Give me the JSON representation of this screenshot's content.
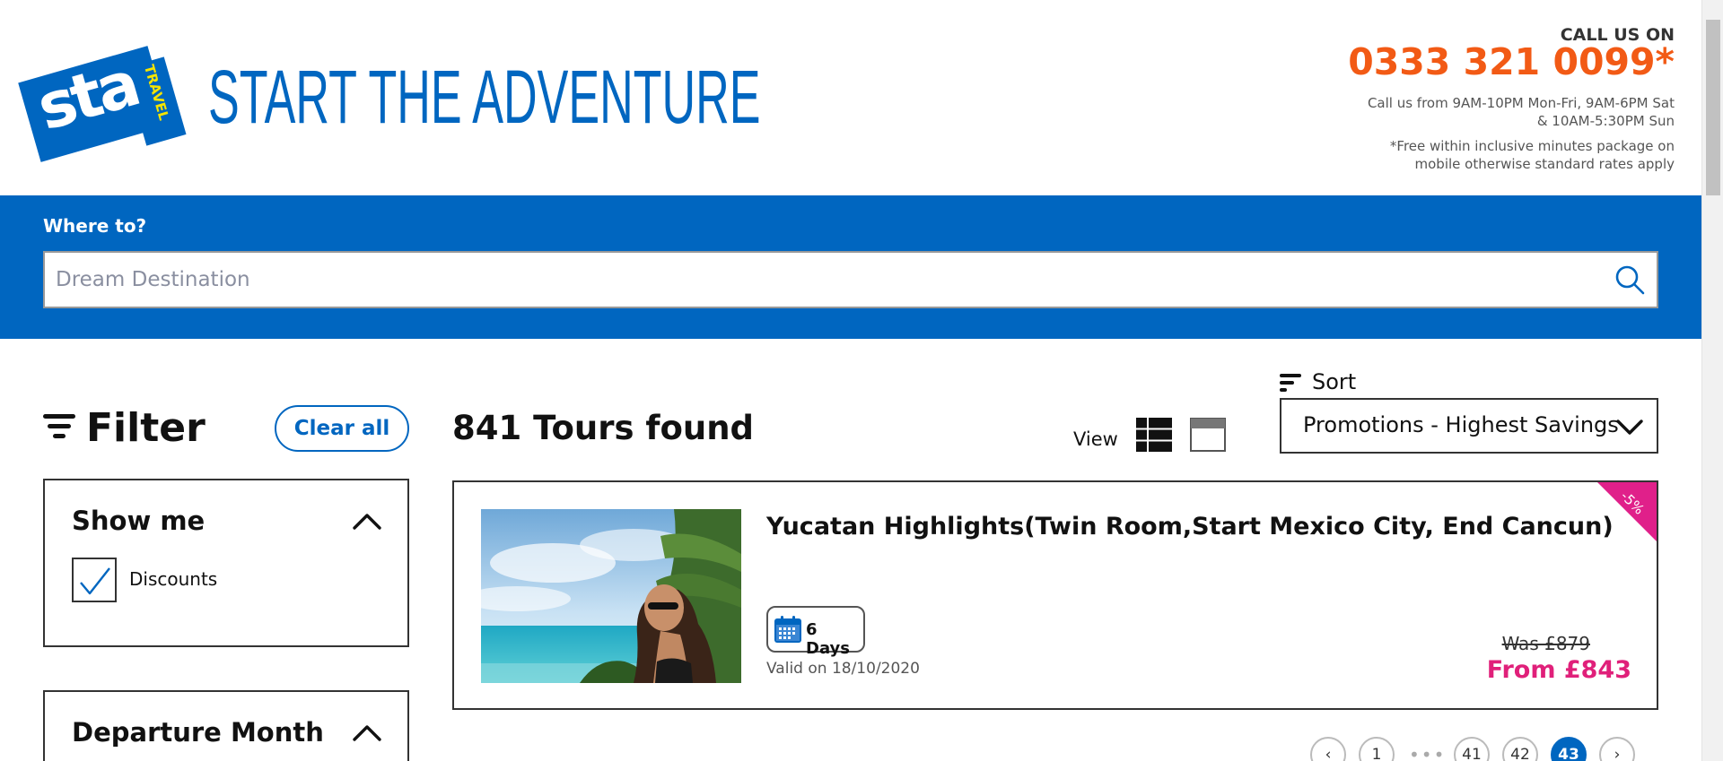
{
  "header": {
    "logo_text": "sta",
    "logo_sub": "TRAVEL",
    "tagline": "START THE ADVENTURE",
    "call_label": "CALL US ON",
    "call_number": "0333 321 0099*",
    "call_hours_1": "Call us from 9AM-10PM Mon-Fri, 9AM-6PM Sat",
    "call_hours_2": "& 10AM-5:30PM Sun",
    "call_note_1": "*Free within inclusive minutes package on",
    "call_note_2": "mobile otherwise standard rates apply"
  },
  "search": {
    "label": "Where to?",
    "placeholder": "Dream Destination",
    "value": "",
    "icon": "search-icon"
  },
  "filter": {
    "title": "Filter",
    "clear_label": "Clear all",
    "panels": [
      {
        "title": "Show me",
        "options": [
          {
            "label": "Discounts",
            "checked": true
          }
        ]
      },
      {
        "title": "Departure Month"
      }
    ]
  },
  "results": {
    "count_text": "841 Tours found",
    "view_label": "View",
    "sort_label": "Sort",
    "sort_value": "Promotions - Highest Savings"
  },
  "tours": [
    {
      "title": "Yucatan Highlights(Twin Room,Start Mexico City, End Cancun)",
      "duration": "6 Days",
      "valid": "Valid on 18/10/2020",
      "was_price": "Was £879",
      "from_price": "From £843",
      "discount": "-5%"
    }
  ],
  "pagination": {
    "pages": [
      "1",
      "41",
      "42",
      "43"
    ],
    "current": "43",
    "ellipsis": "•••"
  },
  "colors": {
    "brand_blue": "#0066c0",
    "phone_orange": "#f25a15",
    "price_pink": "#e0207a"
  }
}
